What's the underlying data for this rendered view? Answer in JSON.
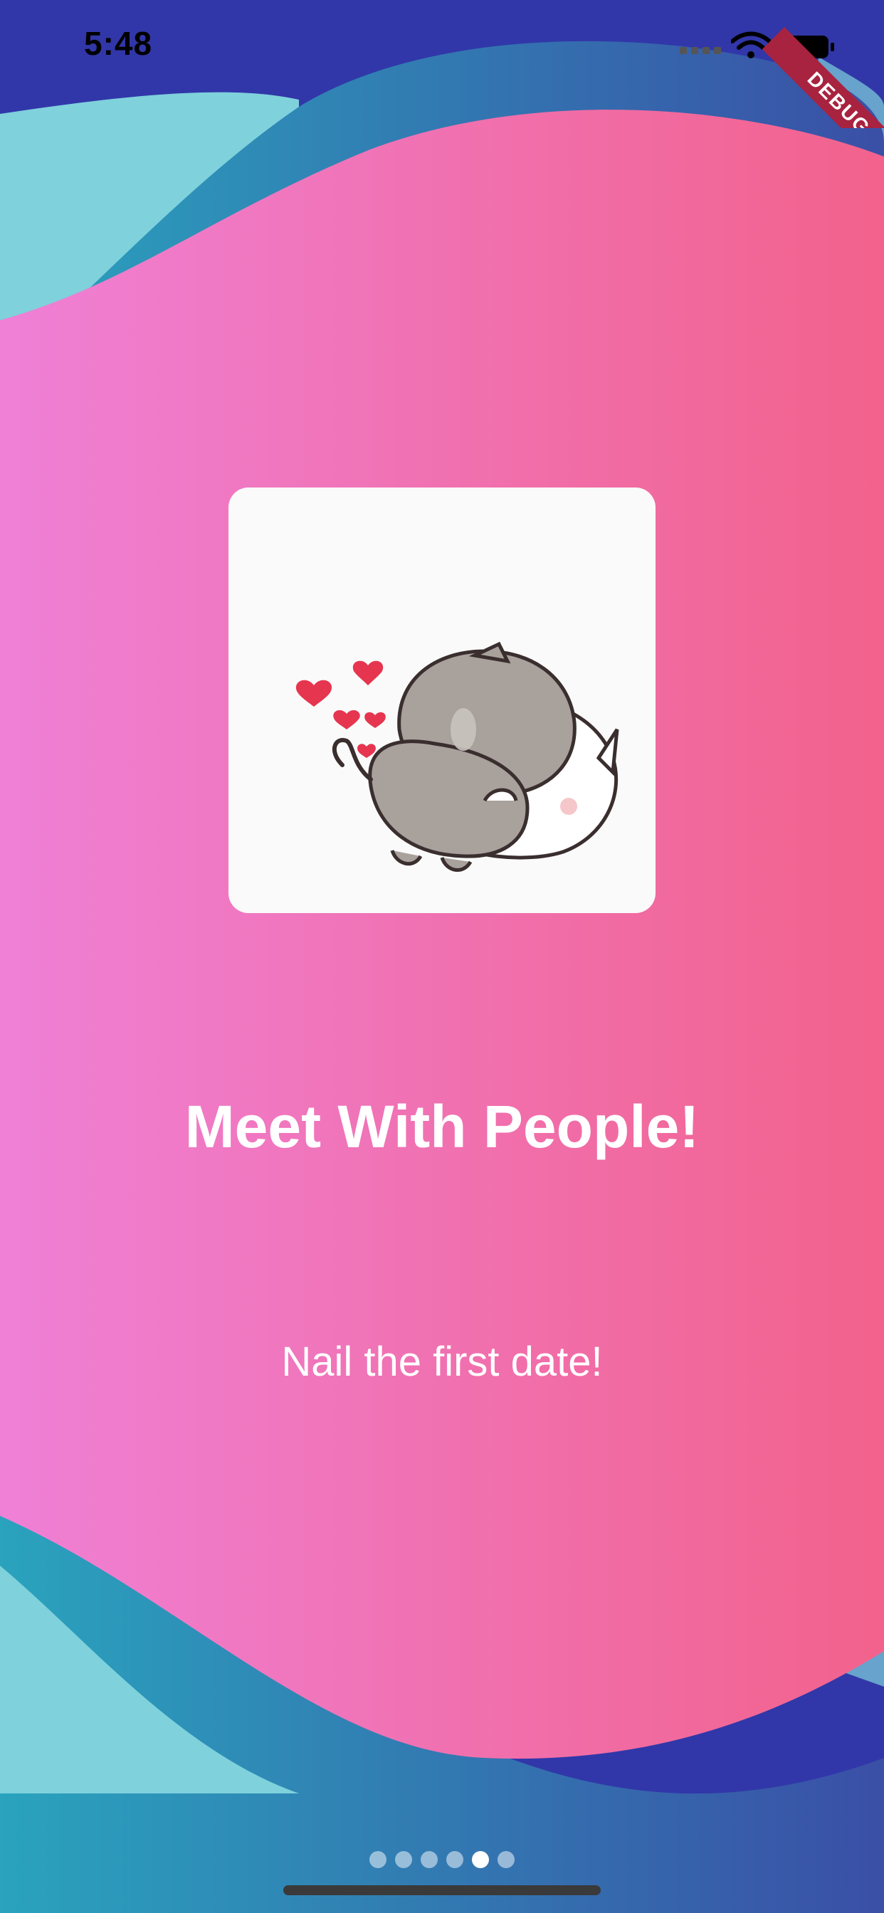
{
  "status_bar": {
    "time": "5:48",
    "signal_icon": "cellular-signal-icon",
    "wifi_icon": "wifi-icon",
    "battery_icon": "battery-icon"
  },
  "debug_banner": {
    "label": "DEBUG"
  },
  "illustration": {
    "icon": "hugging-cats-illustration"
  },
  "onboarding": {
    "title": "Meet With People!",
    "subtitle": "Nail the first date!"
  },
  "pagination": {
    "total": 6,
    "active_index": 4
  },
  "colors": {
    "background": "#3137a8",
    "wave_teal": "#2aa3bd",
    "wave_light": "#7fd1dc",
    "gradient_left": "#ef80d6",
    "gradient_right": "#f2628c",
    "debug_ribbon": "#a8233f"
  }
}
